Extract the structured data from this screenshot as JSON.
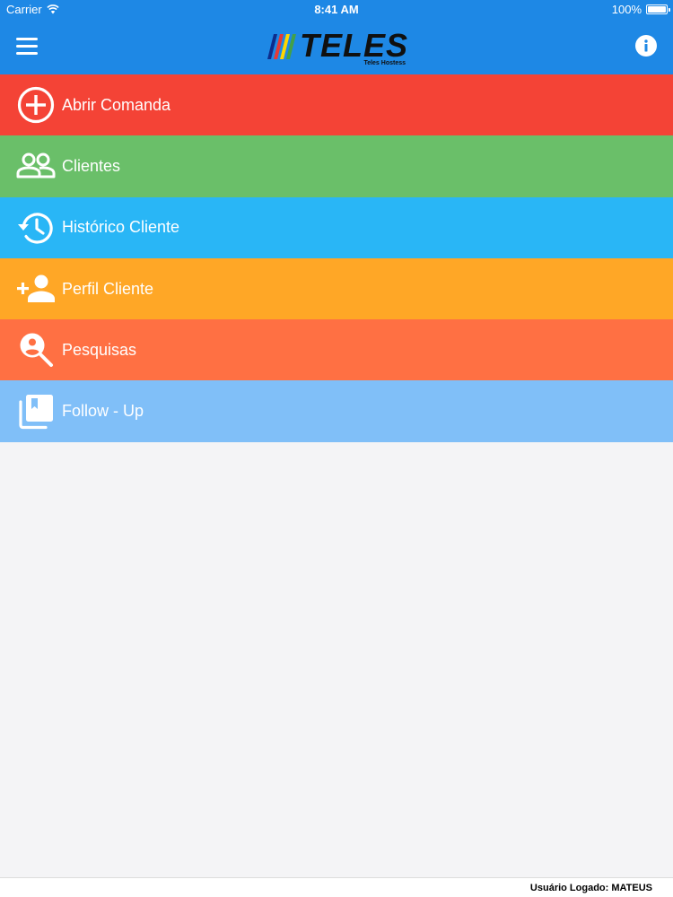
{
  "status_bar": {
    "carrier": "Carrier",
    "time": "8:41 AM",
    "battery": "100%",
    "battery_level": 1.0
  },
  "header": {
    "logo_text": "TELES",
    "logo_subtitle": "Teles Hostess",
    "color": "#1e88e5",
    "menu_icon": "hamburger-icon",
    "info_icon": "info-icon"
  },
  "menu": {
    "items": [
      {
        "label": "Abrir Comanda",
        "icon": "add-circle-icon",
        "color": "#f44336"
      },
      {
        "label": "Clientes",
        "icon": "people-icon",
        "color": "#6abf69"
      },
      {
        "label": "Histórico Cliente",
        "icon": "history-icon",
        "color": "#29b6f6"
      },
      {
        "label": "Perfil Cliente",
        "icon": "add-person-icon",
        "color": "#ffa726"
      },
      {
        "label": "Pesquisas",
        "icon": "person-search-icon",
        "color": "#ff7043"
      },
      {
        "label": "Follow - Up",
        "icon": "library-book-icon",
        "color": "#80bff8"
      }
    ]
  },
  "footer": {
    "logged_user": "Usuário Logado: MATEUS"
  }
}
